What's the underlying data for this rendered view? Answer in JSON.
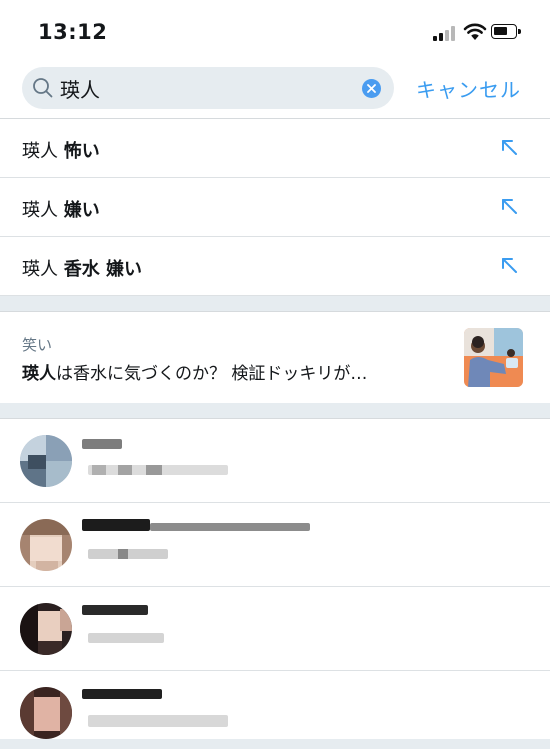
{
  "status_bar": {
    "time": "13:12"
  },
  "search": {
    "query": "瑛人",
    "cancel_label": "キャンセル"
  },
  "suggestions": [
    {
      "prefix": "瑛人",
      "bold": "怖い"
    },
    {
      "prefix": "瑛人",
      "bold": "嫌い"
    },
    {
      "prefix": "瑛人",
      "bold": "香水 嫌い"
    }
  ],
  "moment": {
    "category": "笑い",
    "title_bold": "瑛人",
    "title_rest": "は香水に気づくのか？ 検証ドッキリが…"
  },
  "colors": {
    "accent": "#3a9cf0",
    "separator": "#e6ecf0"
  }
}
